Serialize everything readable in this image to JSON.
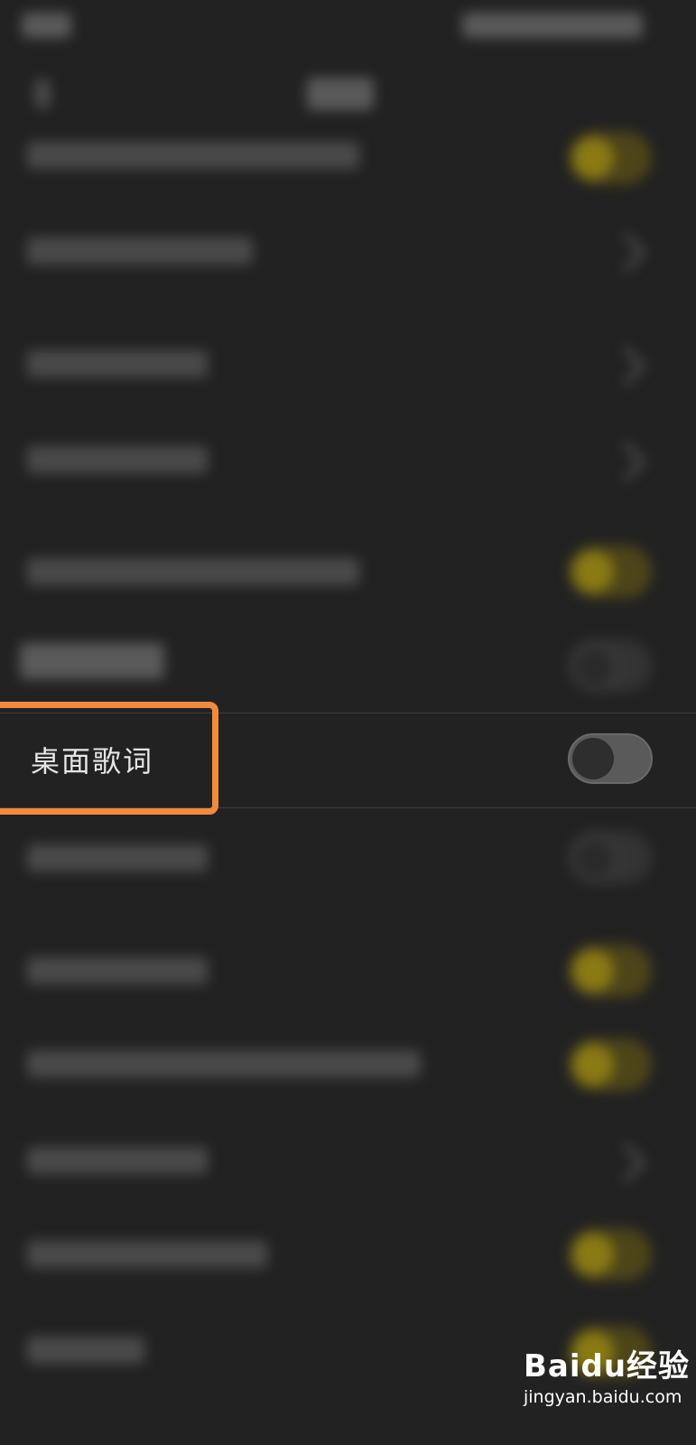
{
  "settings": {
    "desktop_lyrics_label": "桌面歌词",
    "desktop_lyrics_enabled": false
  },
  "watermark": {
    "logo": "Baidu经验",
    "url": "jingyan.baidu.com"
  },
  "colors": {
    "background": "#222222",
    "highlight": "#f08a3c",
    "toggle_on": "#8a7a14"
  }
}
